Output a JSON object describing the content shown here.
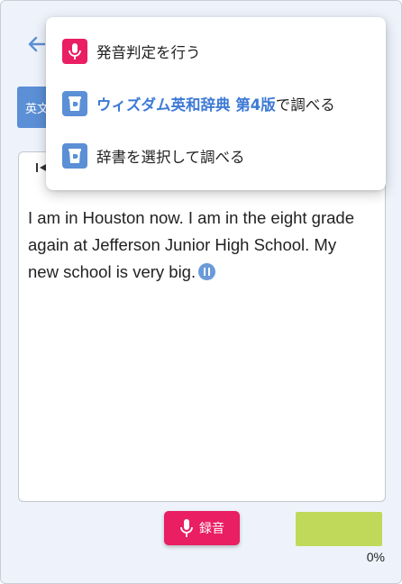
{
  "toolbar": {
    "lang_tab_label": "英文"
  },
  "passage": {
    "text": "I am in Houston now. I am in the eight grade again at Jefferson Junior High School. My new school is very big."
  },
  "bottom": {
    "record_label": "録音",
    "score_percent": "0%"
  },
  "menu": {
    "items": [
      {
        "label": "発音判定を行う",
        "icon": "microphone-icon"
      },
      {
        "dict_name": "ウィズダム英和辞典 第4版",
        "suffix": "で調べる",
        "icon": "dictionary-icon"
      },
      {
        "label": "辞書を選択して調べる",
        "icon": "dictionary-icon"
      }
    ]
  },
  "colors": {
    "accent_red": "#e91e63",
    "accent_blue": "#5b8fd6",
    "score_green": "#c1d95a",
    "background": "#eef3fb"
  }
}
